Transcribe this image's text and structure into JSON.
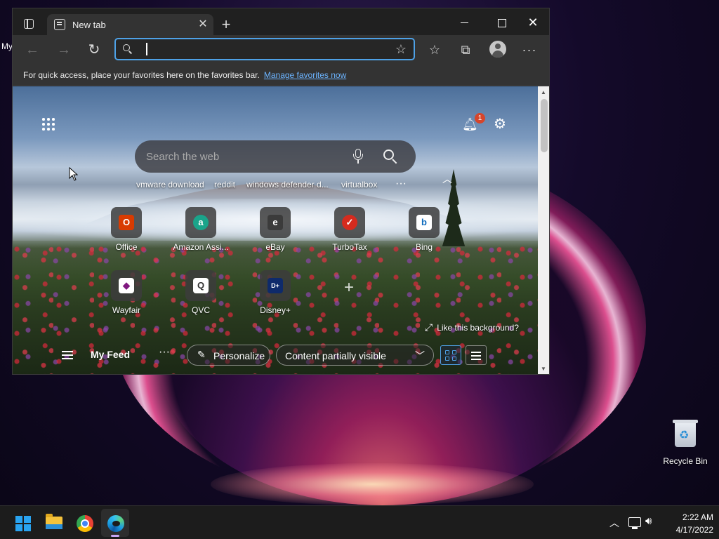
{
  "desktop": {
    "edge_label": "My",
    "recycle_bin_label": "Recycle Bin"
  },
  "browser": {
    "tab_title": "New tab",
    "address_value": "",
    "favorites_bar": {
      "message": "For quick access, place your favorites here on the favorites bar.",
      "link": "Manage favorites now"
    }
  },
  "new_tab_page": {
    "search_placeholder": "Search the web",
    "notification_count": "1",
    "quick_links": [
      "vmware download",
      "reddit",
      "windows defender d...",
      "virtualbox"
    ],
    "tiles": [
      {
        "label": "Office",
        "glyph": "O",
        "color": "#d83b01"
      },
      {
        "label": "Amazon Assi...",
        "glyph": "a",
        "color": "#1aa48a"
      },
      {
        "label": "eBay",
        "glyph": "e",
        "color": "#3b3b3b"
      },
      {
        "label": "TurboTax",
        "glyph": "✓",
        "color": "#d52b1e"
      },
      {
        "label": "Bing",
        "glyph": "b",
        "color": "#ffffff"
      },
      {
        "label": "Wayfair",
        "glyph": "◆",
        "color": "#ffffff"
      },
      {
        "label": "QVC",
        "glyph": "Q",
        "color": "#ffffff"
      },
      {
        "label": "Disney+",
        "glyph": "D+",
        "color": "#0e2a6b"
      }
    ],
    "like_background": "Like this background?",
    "feed": {
      "title": "My Feed",
      "personalize": "Personalize",
      "visibility": "Content partially visible"
    }
  },
  "taskbar": {
    "apps": [
      "start",
      "file-explorer",
      "chrome",
      "edge"
    ],
    "active_app": "edge",
    "time": "2:22 AM",
    "date": "4/17/2022"
  },
  "colors": {
    "accent": "#4ea1e6",
    "notification_badge": "#d6452b",
    "start_blue": "#29a3f0"
  }
}
